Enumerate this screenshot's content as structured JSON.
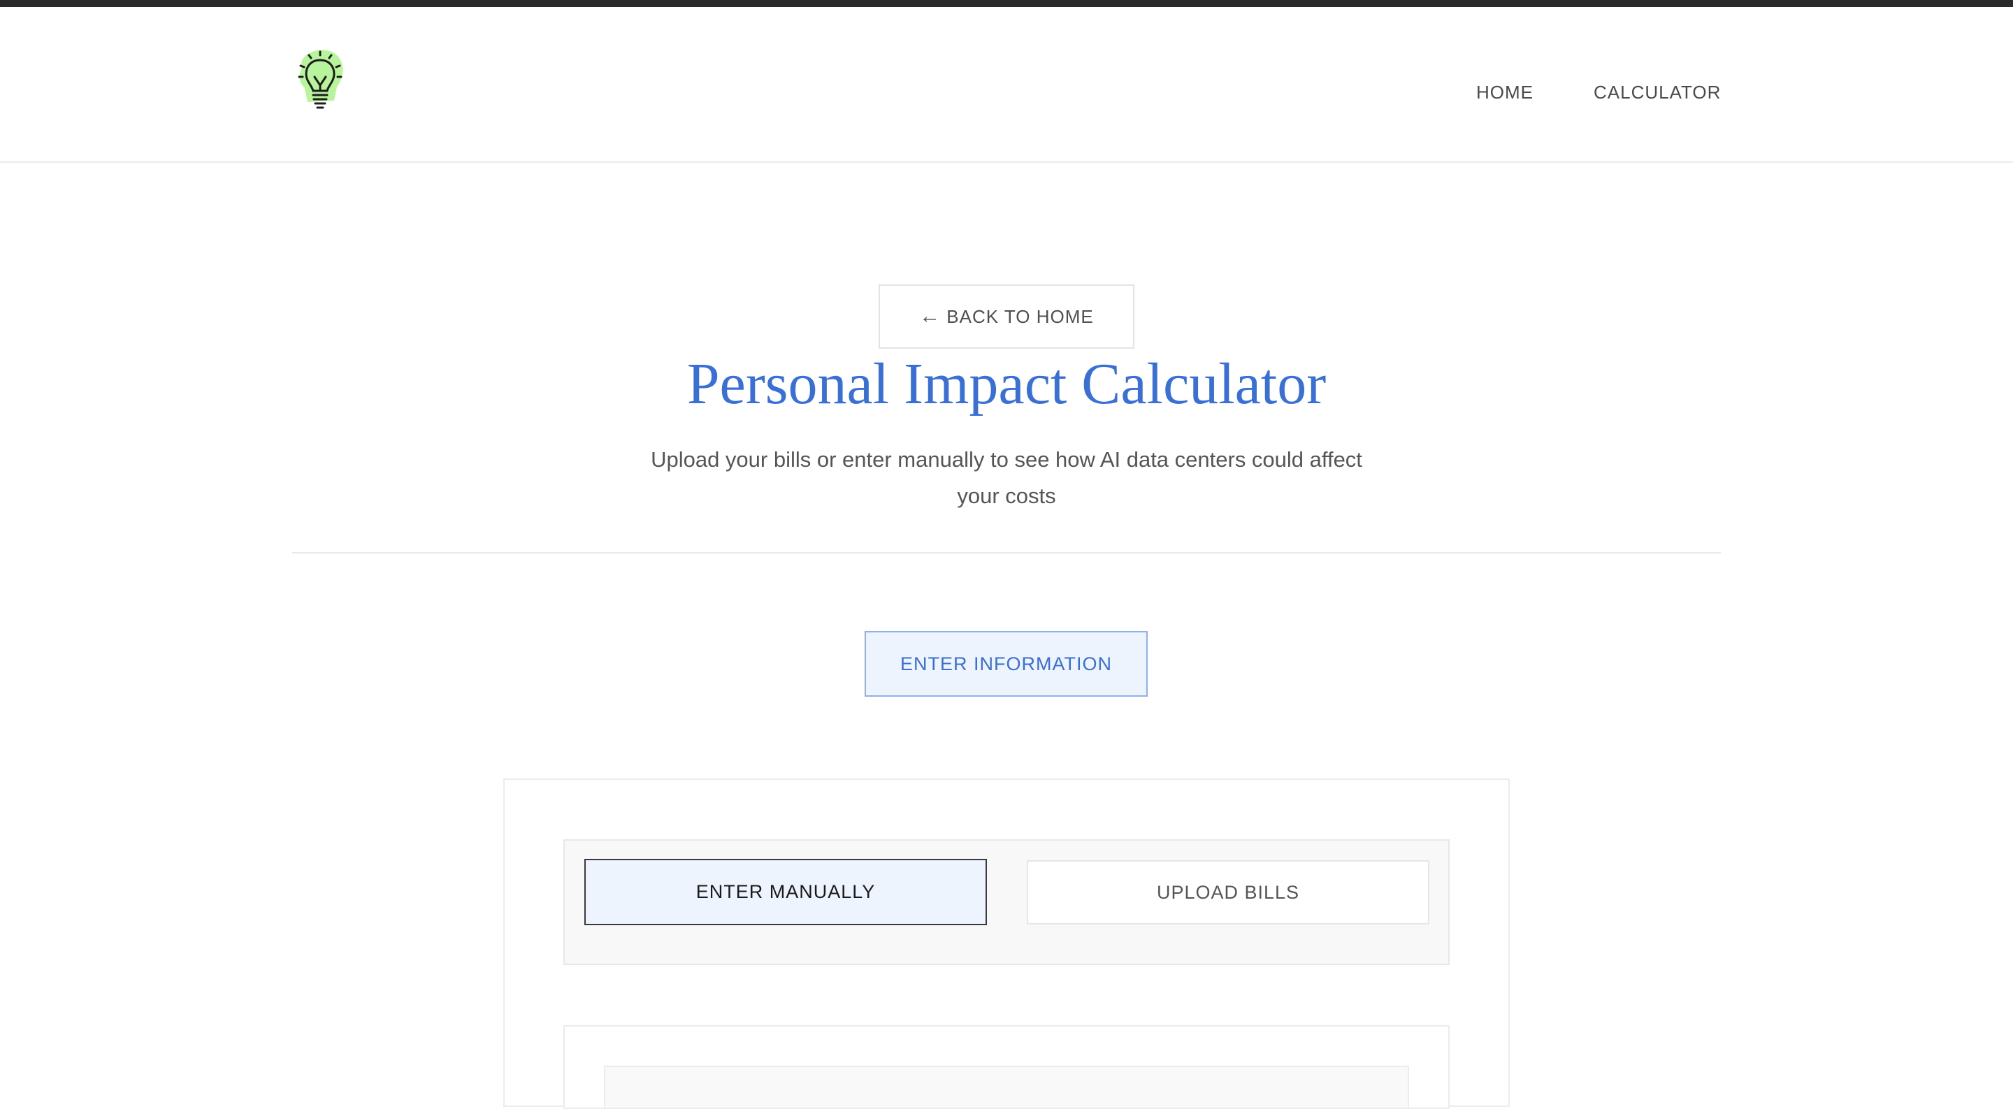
{
  "nav": {
    "home": "HOME",
    "calculator": "CALCULATOR"
  },
  "logo": {
    "icon": "lightbulb-icon"
  },
  "hero": {
    "back_label": "BACK TO HOME",
    "back_arrow": "←",
    "title": "Personal Impact Calculator",
    "subtitle": "Upload your bills or enter manually to see how AI data centers could affect your costs"
  },
  "actions": {
    "enter_information": "ENTER INFORMATION"
  },
  "mode_toggle": {
    "manual": "ENTER MANUALLY",
    "upload": "UPLOAD BILLS",
    "selected": "ENTER MANUALLY"
  },
  "colors": {
    "accent": "#3a6fd6",
    "selected_bg": "#eef4fd"
  }
}
